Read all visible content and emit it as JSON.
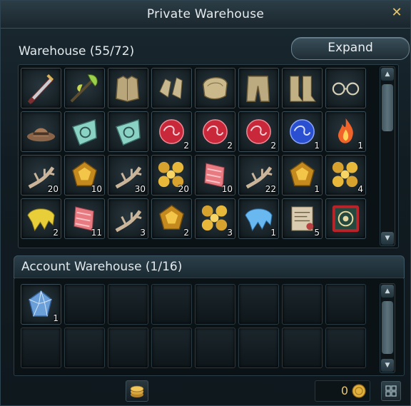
{
  "window": {
    "title": "Private Warehouse",
    "close_glyph": "✕"
  },
  "private": {
    "label": "Warehouse (55/72)",
    "expand_label": "Expand",
    "rows": [
      [
        {
          "icon": "dagger-icon",
          "qty": ""
        },
        {
          "icon": "polearm-icon",
          "qty": ""
        },
        {
          "icon": "chest-armor-icon",
          "qty": ""
        },
        {
          "icon": "gauntlets-icon",
          "qty": ""
        },
        {
          "icon": "pauldron-icon",
          "qty": ""
        },
        {
          "icon": "leg-armor-icon",
          "qty": ""
        },
        {
          "icon": "boots-icon",
          "qty": ""
        },
        {
          "icon": "glasses-icon",
          "qty": ""
        }
      ],
      [
        {
          "icon": "hat-icon",
          "qty": ""
        },
        {
          "icon": "shield-emblem-icon",
          "qty": ""
        },
        {
          "icon": "shield-emblem-icon",
          "qty": ""
        },
        {
          "icon": "red-orb-icon",
          "qty": "2"
        },
        {
          "icon": "red-orb-icon",
          "qty": "2"
        },
        {
          "icon": "red-orb-icon",
          "qty": "2"
        },
        {
          "icon": "blue-orb-icon",
          "qty": "1"
        },
        {
          "icon": "flame-icon",
          "qty": "1"
        }
      ],
      [
        {
          "icon": "antler-icon",
          "qty": "20"
        },
        {
          "icon": "gold-ore-icon",
          "qty": "10"
        },
        {
          "icon": "antler-icon",
          "qty": "30"
        },
        {
          "icon": "gold-nuggets-icon",
          "qty": "20"
        },
        {
          "icon": "pink-scroll-icon",
          "qty": "10"
        },
        {
          "icon": "antler-icon",
          "qty": "22"
        },
        {
          "icon": "gold-ore-icon",
          "qty": "1"
        },
        {
          "icon": "gold-nuggets-icon",
          "qty": "4"
        }
      ],
      [
        {
          "icon": "yellow-goo-icon",
          "qty": "2"
        },
        {
          "icon": "pink-scroll-icon",
          "qty": "11"
        },
        {
          "icon": "antler-icon",
          "qty": "3"
        },
        {
          "icon": "gold-ore-icon",
          "qty": "2"
        },
        {
          "icon": "gold-nuggets-icon",
          "qty": "3"
        },
        {
          "icon": "blue-goo-icon",
          "qty": "1"
        },
        {
          "icon": "map-scroll-icon",
          "qty": "5"
        },
        {
          "icon": "rune-card-icon",
          "qty": ""
        }
      ]
    ]
  },
  "account": {
    "label": "Account Warehouse (1/16)",
    "rows": [
      [
        {
          "icon": "crystal-icon",
          "qty": "1"
        },
        {
          "icon": "",
          "qty": ""
        },
        {
          "icon": "",
          "qty": ""
        },
        {
          "icon": "",
          "qty": ""
        },
        {
          "icon": "",
          "qty": ""
        },
        {
          "icon": "",
          "qty": ""
        },
        {
          "icon": "",
          "qty": ""
        },
        {
          "icon": "",
          "qty": ""
        }
      ],
      [
        {
          "icon": "",
          "qty": ""
        },
        {
          "icon": "",
          "qty": ""
        },
        {
          "icon": "",
          "qty": ""
        },
        {
          "icon": "",
          "qty": ""
        },
        {
          "icon": "",
          "qty": ""
        },
        {
          "icon": "",
          "qty": ""
        },
        {
          "icon": "",
          "qty": ""
        },
        {
          "icon": "",
          "qty": ""
        }
      ]
    ]
  },
  "footer": {
    "money": "0"
  },
  "colors": {
    "accent_gold": "#e8c76b",
    "panel": "#111c22"
  }
}
